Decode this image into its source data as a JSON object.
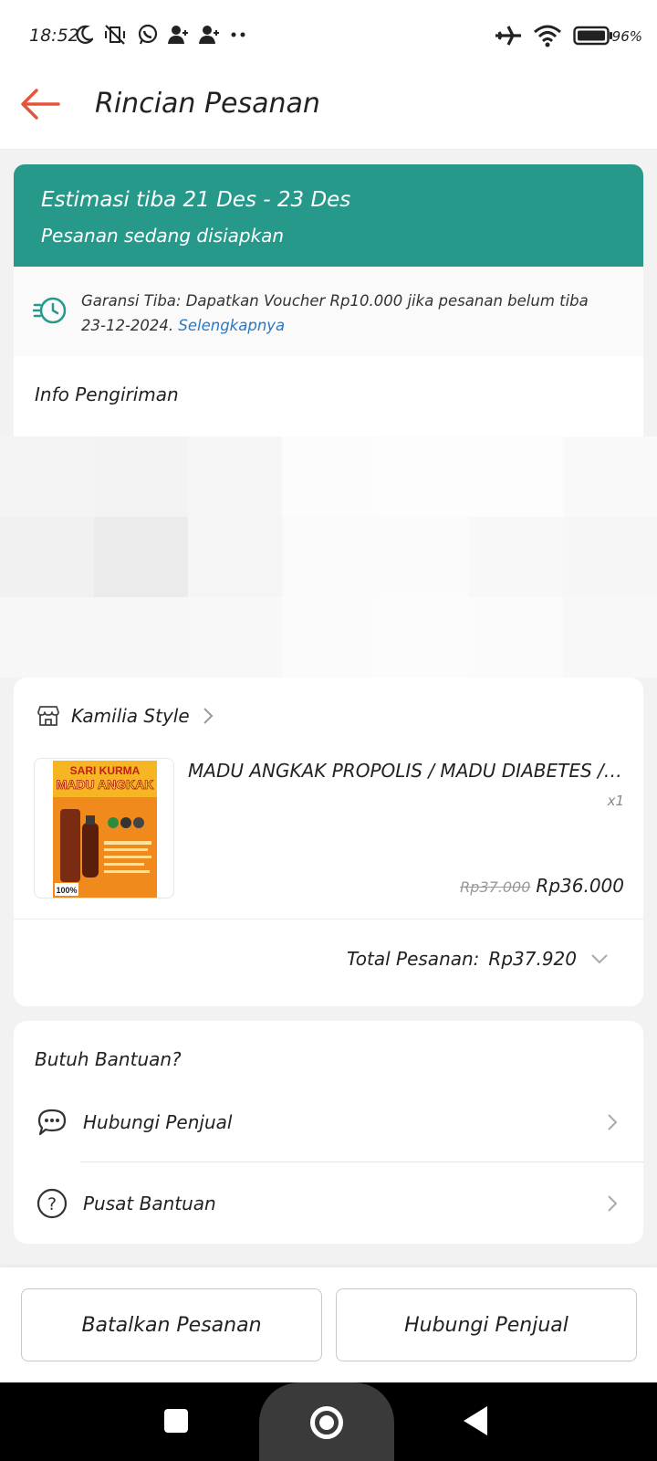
{
  "status_bar": {
    "time": "18:52",
    "battery": "96%"
  },
  "header": {
    "title": "Rincian Pesanan"
  },
  "order_status": {
    "estimate": "Estimasi tiba 21 Des - 23 Des",
    "state": "Pesanan sedang disiapkan",
    "color": "#26998a"
  },
  "guarantee": {
    "text": "Garansi Tiba: Dapatkan Voucher Rp10.000 jika pesanan belum tiba 23-12-2024.",
    "link": "Selengkapnya"
  },
  "shipping": {
    "title": "Info Pengiriman"
  },
  "shop": {
    "name": "Kamilia Style"
  },
  "product": {
    "name": "MADU ANGKAK PROPOLIS / MADU DIABETES / ...",
    "qty": "x1",
    "old_price": "Rp37.000",
    "price": "Rp36.000",
    "image_text": {
      "line1": "SARI KURMA",
      "line2": "MADU ANGKAK",
      "badge": "100%"
    }
  },
  "total": {
    "label": "Total Pesanan:",
    "value": "Rp37.920"
  },
  "help": {
    "title": "Butuh Bantuan?",
    "items": [
      {
        "label": "Hubungi Penjual",
        "icon": "chat-icon"
      },
      {
        "label": "Pusat Bantuan",
        "icon": "question-icon"
      }
    ]
  },
  "actions": {
    "cancel": "Batalkan Pesanan",
    "contact": "Hubungi Penjual"
  }
}
